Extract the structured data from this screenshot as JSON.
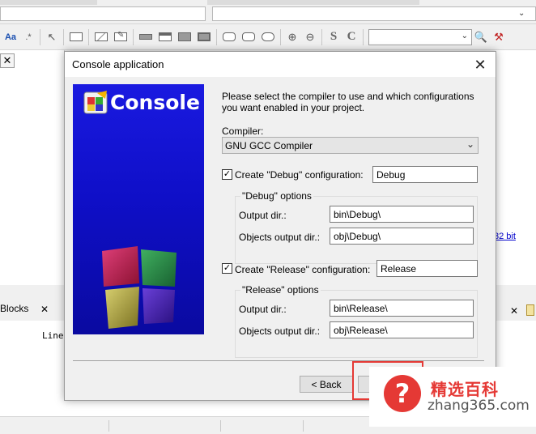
{
  "background_ide": {
    "link_text": "32 bit",
    "blocks_tab": "Blocks",
    "editor_line": "Line"
  },
  "dialog": {
    "title": "Console application",
    "banner_title": "Console",
    "intro_text": "Please select the compiler to use and which configurations you want enabled in your project.",
    "compiler_label": "Compiler:",
    "compiler_value": "GNU GCC Compiler",
    "debug": {
      "checkbox_label": "Create \"Debug\" configuration:",
      "checked": true,
      "name_value": "Debug",
      "group_title": "\"Debug\" options",
      "output_dir_label": "Output dir.:",
      "output_dir_value": "bin\\Debug\\",
      "objects_dir_label": "Objects output dir.:",
      "objects_dir_value": "obj\\Debug\\"
    },
    "release": {
      "checkbox_label": "Create \"Release\" configuration:",
      "checked": true,
      "name_value": "Release",
      "group_title": "\"Release\" options",
      "output_dir_label": "Output dir.:",
      "output_dir_value": "bin\\Release\\",
      "objects_dir_label": "Objects output dir.:",
      "objects_dir_value": "obj\\Release\\"
    },
    "back_button": "< Back"
  },
  "watermark": {
    "cn_text": "精选百科",
    "url": "zhang365.com"
  },
  "colors": {
    "banner_blue": "#1510d0",
    "highlight_red": "#e53935"
  }
}
